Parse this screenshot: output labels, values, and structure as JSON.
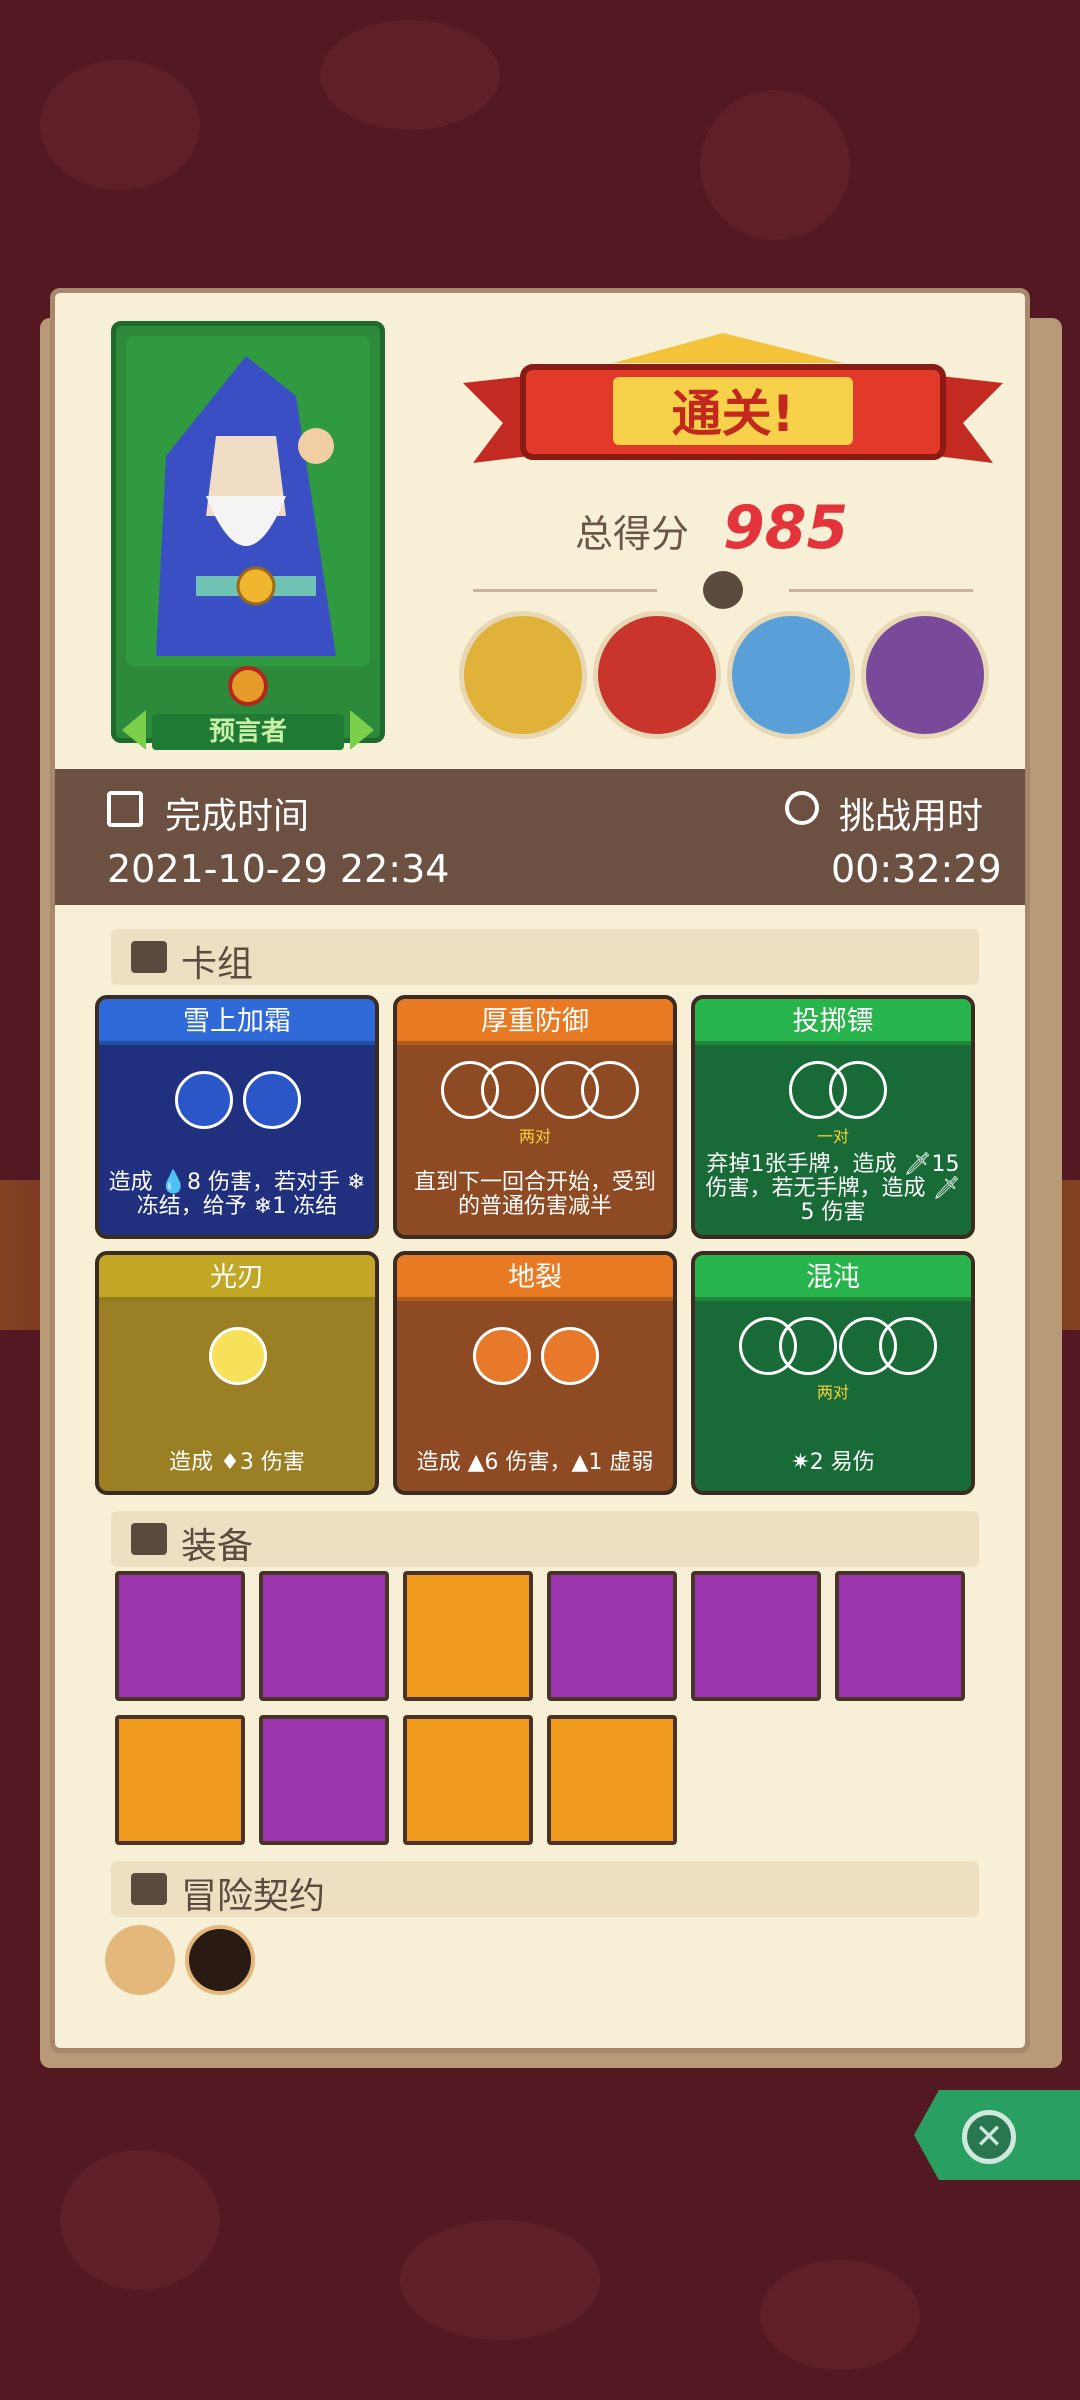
{
  "result": {
    "banner": "通关!",
    "score_label": "总得分",
    "score": "985"
  },
  "hero": {
    "name": "预言者"
  },
  "bosses": [
    "boss-witch-icon",
    "boss-robot-icon",
    "boss-yeti-icon",
    "boss-dragon-icon"
  ],
  "times": {
    "complete_label": "完成时间",
    "complete_value": "2021-10-29 22:34",
    "challenge_label": "挑战用时",
    "challenge_value": "00:32:29"
  },
  "sections": {
    "deck": "卡组",
    "equipment": "装备",
    "contract": "冒险契约"
  },
  "cards": [
    {
      "title": "雪上加霜",
      "desc": "造成 💧8 伤害，若对手 ❄ 冻结，给予 ❄1 冻结",
      "sub": ""
    },
    {
      "title": "厚重防御",
      "desc": "直到下一回合开始，受到的普通伤害减半",
      "sub": "两对"
    },
    {
      "title": "投掷镖",
      "desc": "弃掉1张手牌，造成 🗡15 伤害，若无手牌，造成 🗡5 伤害",
      "sub": "一对"
    },
    {
      "title": "光刃",
      "desc": "造成 ♦3 伤害",
      "sub": ""
    },
    {
      "title": "地裂",
      "desc": "造成 ▲6 伤害，▲1 虚弱",
      "sub": ""
    },
    {
      "title": "混沌",
      "desc": "✷2 易伤",
      "sub": "两对"
    }
  ],
  "equipment": [
    "mushroom-icon",
    "skull-book-icon",
    "vase-icon",
    "fire-ring-icon",
    "cheese-icon",
    "tunic-icon",
    "colorful-bowl-icon",
    "flame-heart-icon",
    "crown-box-icon",
    "gem-shield-icon"
  ],
  "contracts": [
    "scroll-icon",
    "horn-icon"
  ],
  "colors": {
    "accent_score": "#e2343a",
    "panel": "#f8efd7",
    "background": "#531821"
  }
}
